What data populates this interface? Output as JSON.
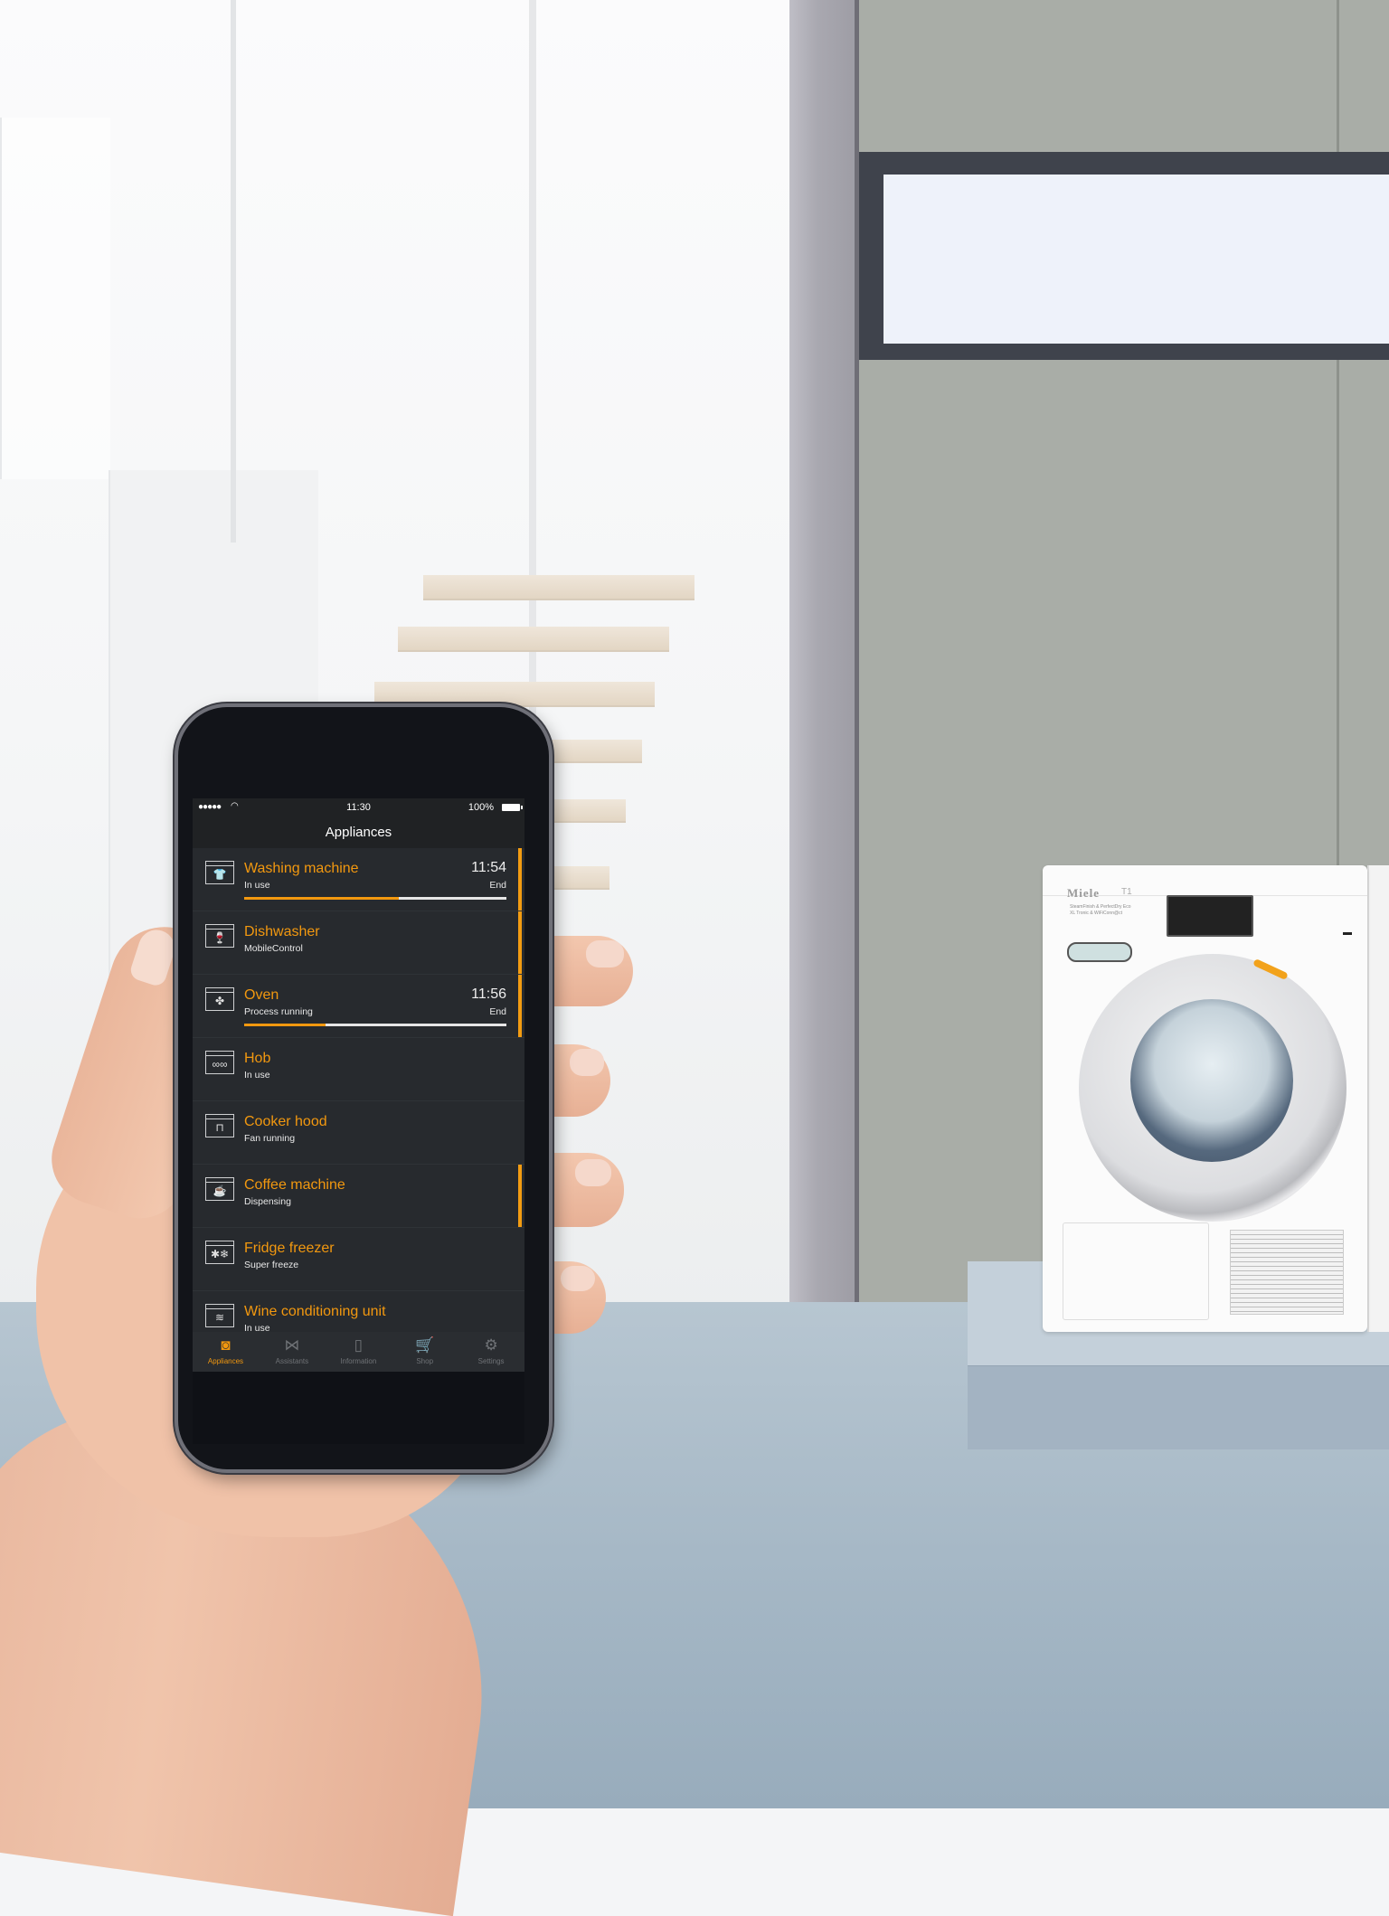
{
  "scene": {
    "dryer": {
      "brand": "Miele",
      "model": "T1",
      "features_line1": "SteamFinish & PerfectDry Eco",
      "features_line2": "XL Tronic & WiFiConn@ct"
    }
  },
  "phone": {
    "status_bar": {
      "signal": "●●●●●",
      "wifi_icon": "wifi-icon",
      "time": "11:30",
      "battery": "100%"
    },
    "title": "Appliances",
    "colors": {
      "accent": "#f2980f",
      "background": "#24272b",
      "text": "#e8e8e8"
    },
    "appliances": [
      {
        "name": "Washing machine",
        "status": "In use",
        "end_time": "11:54",
        "end_label": "End",
        "progress_percent": 59,
        "icon": "washing-machine-icon",
        "glyph": "👕",
        "active": true
      },
      {
        "name": "Dishwasher",
        "status": "MobileControl",
        "end_time": "",
        "end_label": "",
        "progress_percent": null,
        "icon": "dishwasher-icon",
        "glyph": "🍷",
        "active": true
      },
      {
        "name": "Oven",
        "status": "Process running",
        "end_time": "11:56",
        "end_label": "End",
        "progress_percent": 31,
        "icon": "oven-fan-icon",
        "glyph": "✤",
        "active": true
      },
      {
        "name": "Hob",
        "status": "In use",
        "end_time": "",
        "end_label": "",
        "progress_percent": null,
        "icon": "hob-icon",
        "glyph": "∞∞",
        "active": false
      },
      {
        "name": "Cooker hood",
        "status": "Fan running",
        "end_time": "",
        "end_label": "",
        "progress_percent": null,
        "icon": "cooker-hood-icon",
        "glyph": "⊓",
        "active": false
      },
      {
        "name": "Coffee machine",
        "status": "Dispensing",
        "end_time": "",
        "end_label": "",
        "progress_percent": null,
        "icon": "coffee-cup-icon",
        "glyph": "☕",
        "active": true
      },
      {
        "name": "Fridge freezer",
        "status": "Super freeze",
        "end_time": "",
        "end_label": "",
        "progress_percent": null,
        "icon": "snowflake-icon",
        "glyph": "✱❄",
        "active": false
      },
      {
        "name": "Wine conditioning unit",
        "status": "In use",
        "end_time": "",
        "end_label": "",
        "progress_percent": null,
        "icon": "wine-bottles-icon",
        "glyph": "≋",
        "active": false
      }
    ],
    "tabs": [
      {
        "label": "Appliances",
        "icon": "appliance-icon",
        "glyph": "◙",
        "active": true
      },
      {
        "label": "Assistants",
        "icon": "tuxedo-icon",
        "glyph": "⋈",
        "active": false
      },
      {
        "label": "Information",
        "icon": "book-icon",
        "glyph": "▯",
        "active": false
      },
      {
        "label": "Shop",
        "icon": "cart-icon",
        "glyph": "🛒",
        "active": false
      },
      {
        "label": "Settings",
        "icon": "gear-icon",
        "glyph": "⚙",
        "active": false
      }
    ]
  }
}
